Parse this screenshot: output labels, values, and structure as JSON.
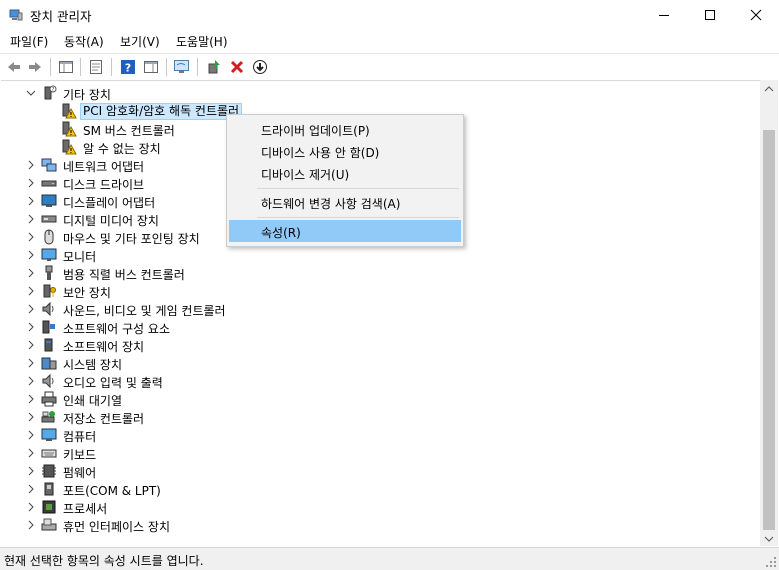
{
  "window": {
    "title": "장치 관리자"
  },
  "menu": [
    "파일(F)",
    "동작(A)",
    "보기(V)",
    "도움말(H)"
  ],
  "tree": {
    "expanded_category": "기타 장치",
    "children": [
      {
        "label": "PCI 암호화/암호 해독 컨트롤러",
        "selected": true
      },
      {
        "label": "SM 버스 컨트롤러",
        "selected": false
      },
      {
        "label": "알 수 없는 장치",
        "selected": false
      }
    ],
    "categories": [
      {
        "label": "네트워크 어댑터",
        "icon": "network-icon"
      },
      {
        "label": "디스크 드라이브",
        "icon": "disk-icon"
      },
      {
        "label": "디스플레이 어댑터",
        "icon": "display-icon"
      },
      {
        "label": "디지털 미디어 장치",
        "icon": "media-icon"
      },
      {
        "label": "마우스 및 기타 포인팅 장치",
        "icon": "mouse-icon"
      },
      {
        "label": "모니터",
        "icon": "monitor-icon"
      },
      {
        "label": "범용 직렬 버스 컨트롤러",
        "icon": "usb-icon"
      },
      {
        "label": "보안 장치",
        "icon": "security-icon"
      },
      {
        "label": "사운드, 비디오 및 게임 컨트롤러",
        "icon": "sound-icon"
      },
      {
        "label": "소프트웨어 구성 요소",
        "icon": "software-component-icon"
      },
      {
        "label": "소프트웨어 장치",
        "icon": "software-device-icon"
      },
      {
        "label": "시스템 장치",
        "icon": "system-icon"
      },
      {
        "label": "오디오 입력 및 출력",
        "icon": "audio-icon"
      },
      {
        "label": "인쇄 대기열",
        "icon": "printer-icon"
      },
      {
        "label": "저장소 컨트롤러",
        "icon": "storage-icon"
      },
      {
        "label": "컴퓨터",
        "icon": "computer-icon"
      },
      {
        "label": "키보드",
        "icon": "keyboard-icon"
      },
      {
        "label": "펌웨어",
        "icon": "firmware-icon"
      },
      {
        "label": "포트(COM & LPT)",
        "icon": "port-icon"
      },
      {
        "label": "프로세서",
        "icon": "processor-icon"
      },
      {
        "label": "휴먼 인터페이스 장치",
        "icon": "hid-icon"
      }
    ]
  },
  "context_menu": {
    "items": [
      {
        "label": "드라이버 업데이트(P)",
        "highlighted": false
      },
      {
        "label": "디바이스 사용 안 함(D)",
        "highlighted": false
      },
      {
        "label": "디바이스 제거(U)",
        "highlighted": false
      },
      {
        "label": "하드웨어 변경 사항 검색(A)",
        "highlighted": false
      },
      {
        "label": "속성(R)",
        "highlighted": true
      }
    ]
  },
  "status": {
    "text": "현재 선택한 항목의 속성 시트를 엽니다."
  },
  "colors": {
    "selection": "#cce8ff",
    "menu_highlight": "#91c9f7",
    "warning": "#f5c518",
    "toolbar_red": "#d11f1f",
    "toolbar_blue": "#1f5fbf"
  }
}
